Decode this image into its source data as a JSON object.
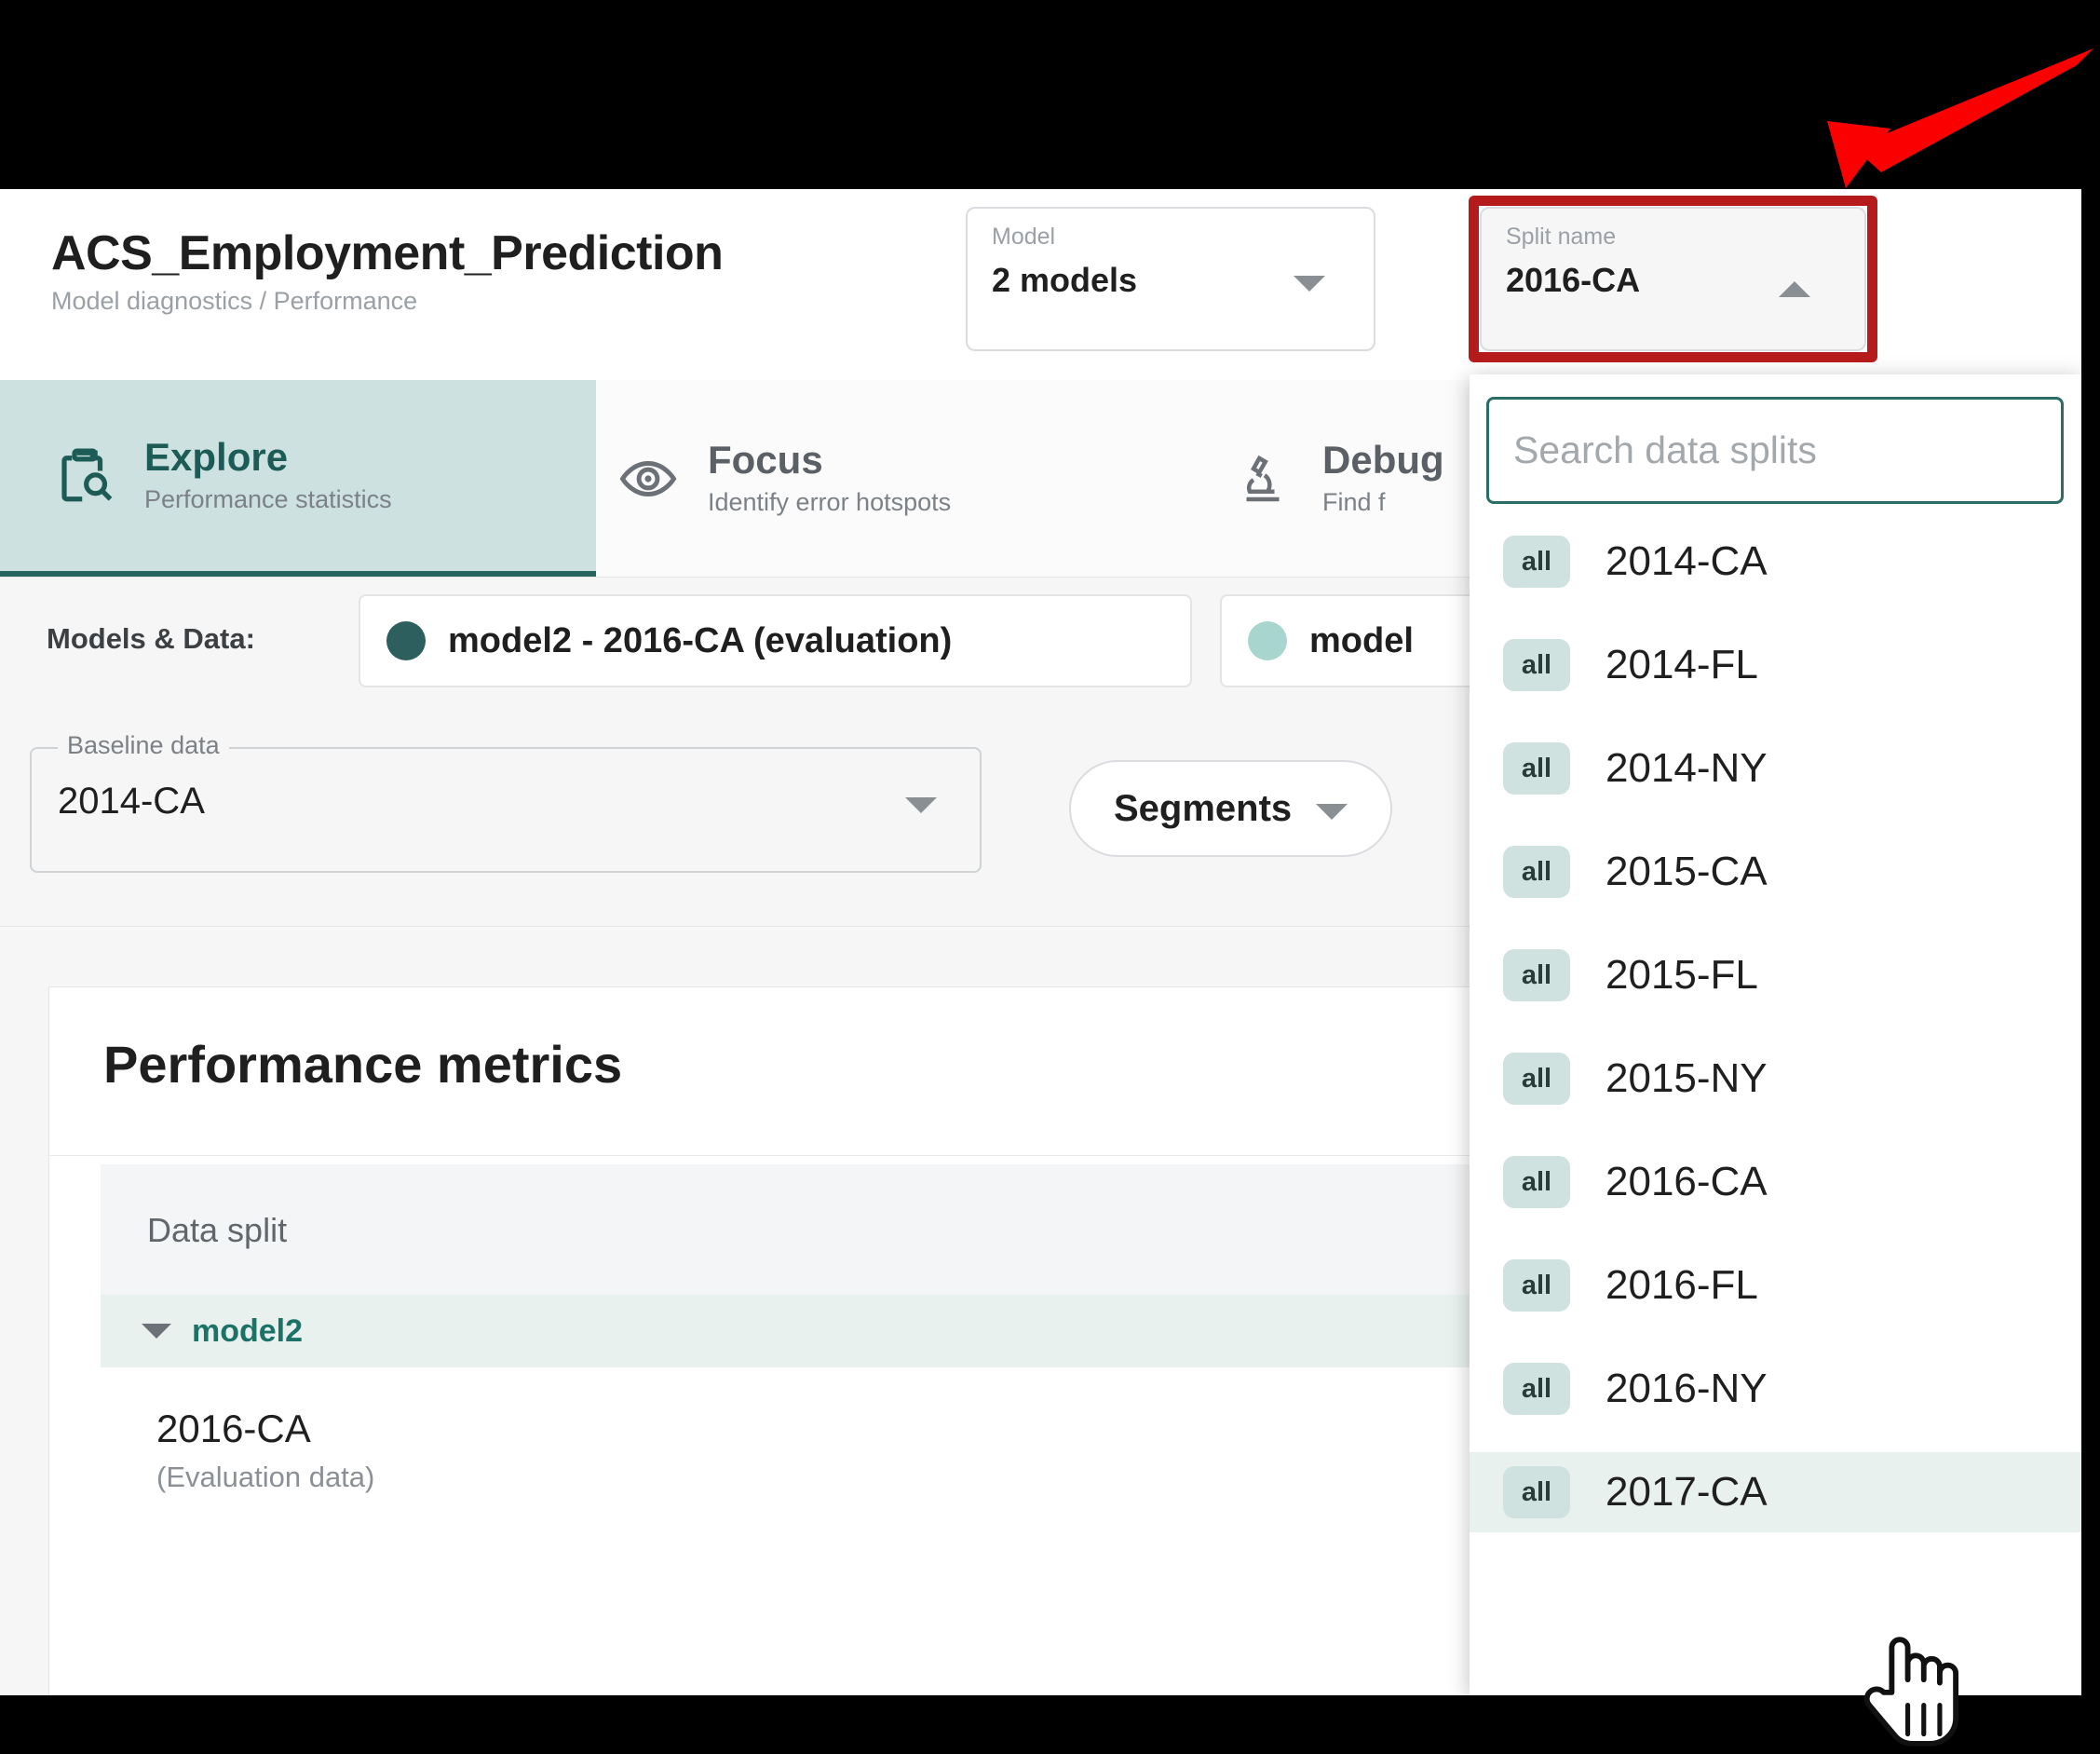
{
  "header": {
    "title": "ACS_Employment_Prediction",
    "breadcrumb": "Model diagnostics / Performance",
    "model_select": {
      "label": "Model",
      "value": "2 models",
      "icon": "chevron-down-icon"
    },
    "split_select": {
      "label": "Split name",
      "value": "2016-CA",
      "icon": "chevron-up-icon"
    }
  },
  "tabs": [
    {
      "label": "Explore",
      "sub": "Performance statistics",
      "icon": "clipboard-search-icon",
      "active": true
    },
    {
      "label": "Focus",
      "sub": "Identify error hotspots",
      "icon": "eye-icon",
      "active": false
    },
    {
      "label": "Debug",
      "sub": "Find f",
      "icon": "microscope-icon",
      "active": false
    }
  ],
  "models_row": {
    "label": "Models & Data:",
    "chips": [
      {
        "text": "model2 - 2016-CA (evaluation)",
        "color": "#2c5f5d"
      },
      {
        "text": "model",
        "color": "#a8d5cd"
      }
    ]
  },
  "controls": {
    "baseline": {
      "legend": "Baseline data",
      "value": "2014-CA",
      "icon": "chevron-down-icon"
    },
    "segments": {
      "label": "Segments",
      "icon": "chevron-down-icon"
    }
  },
  "card": {
    "title": "Performance metrics",
    "column_header": "Data split",
    "group_row": {
      "name": "model2",
      "icon": "triangle-down-icon"
    },
    "row": {
      "name": "2016-CA",
      "sub": "(Evaluation data)"
    }
  },
  "dropdown": {
    "search_placeholder": "Search data splits",
    "search_value": "",
    "items": [
      {
        "badge": "all",
        "label": "2014-CA",
        "highlighted": false
      },
      {
        "badge": "all",
        "label": "2014-FL",
        "highlighted": false
      },
      {
        "badge": "all",
        "label": "2014-NY",
        "highlighted": false
      },
      {
        "badge": "all",
        "label": "2015-CA",
        "highlighted": false
      },
      {
        "badge": "all",
        "label": "2015-FL",
        "highlighted": false
      },
      {
        "badge": "all",
        "label": "2015-NY",
        "highlighted": false
      },
      {
        "badge": "all",
        "label": "2016-CA",
        "highlighted": false
      },
      {
        "badge": "all",
        "label": "2016-FL",
        "highlighted": false
      },
      {
        "badge": "all",
        "label": "2016-NY",
        "highlighted": false
      },
      {
        "badge": "all",
        "label": "2017-CA",
        "highlighted": true
      }
    ]
  },
  "annotation": {
    "highlight_color": "#b61b1b",
    "arrow_color": "#fb0000"
  },
  "theme": {
    "accent": "#1d7268",
    "tab_active_bg": "#cde2e0",
    "badge_bg": "#cfe2df",
    "highlight_row_bg": "#e9f1ef"
  }
}
